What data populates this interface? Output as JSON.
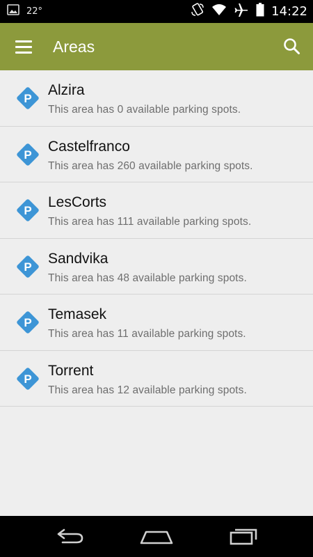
{
  "status_bar": {
    "temperature": "22°",
    "time": "14:22",
    "icons": [
      "gallery-icon",
      "rotation-icon",
      "wifi-icon",
      "airplane-icon",
      "battery-icon"
    ]
  },
  "app_bar": {
    "title": "Areas",
    "color": "#8c9a3c",
    "menu_icon": "menu-icon",
    "search_icon": "search-icon"
  },
  "areas": [
    {
      "name": "Alzira",
      "description": "This area has 0 available parking spots."
    },
    {
      "name": "Castelfranco",
      "description": "This area has 260 available parking spots."
    },
    {
      "name": "LesCorts",
      "description": "This area has 111 available parking spots."
    },
    {
      "name": "Sandvika",
      "description": "This area has 48 available parking spots."
    },
    {
      "name": "Temasek",
      "description": "This area has 11 available parking spots."
    },
    {
      "name": "Torrent",
      "description": "This area has 12 available parking spots."
    }
  ],
  "parking_icon": {
    "glyph": "P",
    "color": "#3d95d6"
  },
  "nav_bar": {
    "icons": [
      "back-icon",
      "home-icon",
      "recents-icon"
    ]
  }
}
